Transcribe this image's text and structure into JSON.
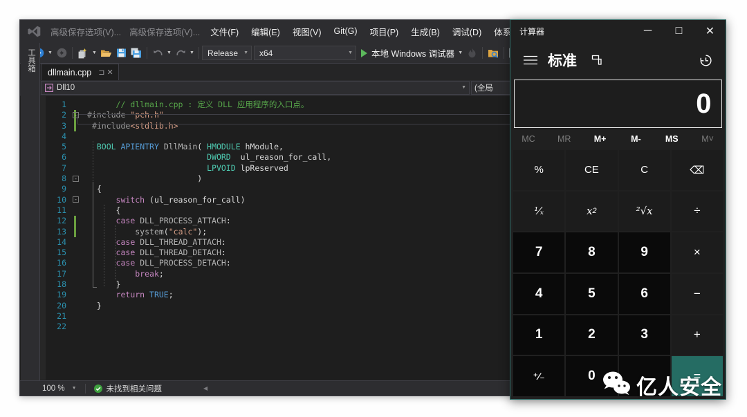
{
  "vs": {
    "logo_name": "visual-studio-logo",
    "menu": {
      "recent_1": "高级保存选项(V)...",
      "recent_2": "高级保存选项(V)...",
      "items": [
        "文件(F)",
        "编辑(E)",
        "视图(V)",
        "Git(G)",
        "项目(P)",
        "生成(B)",
        "调试(D)",
        "体系结构(C)"
      ]
    },
    "toolbar": {
      "config": "Release",
      "platform": "x64",
      "run_label": "本地 Windows 调试器"
    },
    "toolbox_label": "工具箱",
    "tab": {
      "filename": "dllmain.cpp",
      "pin_glyph": "⊐",
      "close_glyph": "✕"
    },
    "navbar": {
      "project": "Dll10",
      "scope": "(全局"
    },
    "status": {
      "zoom": "100 %",
      "message": "未找到相关问题"
    },
    "code": [
      {
        "n": "1",
        "changed": false,
        "fold": "",
        "html": "      <span class='c-com'>// dllmain.cpp : 定义 DLL 应用程序的入口点。</span>"
      },
      {
        "n": "2",
        "changed": true,
        "fold": "-",
        "html": "<span class='c-pre'>#include</span> <span class='c-str'>\"pch.h\"</span>"
      },
      {
        "n": "3",
        "changed": true,
        "fold": "",
        "html": " <span class='c-pre'>#include</span><span class='c-str'>&lt;stdlib.h&gt;</span>"
      },
      {
        "n": "4",
        "changed": false,
        "fold": "",
        "html": ""
      },
      {
        "n": "5",
        "changed": false,
        "fold": "",
        "html": "  <span class='c-typ'>BOOL</span> <span class='c-kw'>APIENTRY</span> <span class='c-mac'>DllMain</span>( <span class='c-typ'>HMODULE</span> hModule,"
      },
      {
        "n": "6",
        "changed": false,
        "fold": "",
        "html": "                         <span class='c-typ'>DWORD</span>  ul_reason_for_call,"
      },
      {
        "n": "7",
        "changed": false,
        "fold": "",
        "html": "                         <span class='c-typ'>LPVOID</span> lpReserved"
      },
      {
        "n": "8",
        "changed": false,
        "fold": "-",
        "html": "                       )"
      },
      {
        "n": "9",
        "changed": false,
        "fold": "",
        "html": "  {"
      },
      {
        "n": "10",
        "changed": false,
        "fold": "-",
        "html": "      <span class='c-kw2'>switch</span> (ul_reason_for_call)"
      },
      {
        "n": "11",
        "changed": false,
        "fold": "",
        "html": "      {"
      },
      {
        "n": "12",
        "changed": true,
        "fold": "",
        "html": "      <span class='c-kw2'>case</span> <span class='c-mac'>DLL_PROCESS_ATTACH</span>:"
      },
      {
        "n": "13",
        "changed": true,
        "fold": "",
        "html": "          <span class='c-mac'>system</span>(<span class='c-str'>\"calc\"</span>);"
      },
      {
        "n": "14",
        "changed": false,
        "fold": "",
        "html": "      <span class='c-kw2'>case</span> <span class='c-mac'>DLL_THREAD_ATTACH</span>:"
      },
      {
        "n": "15",
        "changed": false,
        "fold": "",
        "html": "      <span class='c-kw2'>case</span> <span class='c-mac'>DLL_THREAD_DETACH</span>:"
      },
      {
        "n": "16",
        "changed": false,
        "fold": "",
        "html": "      <span class='c-kw2'>case</span> <span class='c-mac'>DLL_PROCESS_DETACH</span>:"
      },
      {
        "n": "17",
        "changed": false,
        "fold": "",
        "html": "          <span class='c-kw2'>break</span>;"
      },
      {
        "n": "18",
        "changed": false,
        "fold": "",
        "html": "      }"
      },
      {
        "n": "19",
        "changed": false,
        "fold": "",
        "html": "      <span class='c-kw2'>return</span> <span class='c-kw'>TRUE</span>;"
      },
      {
        "n": "20",
        "changed": false,
        "fold": "",
        "html": "  }"
      },
      {
        "n": "21",
        "changed": false,
        "fold": "",
        "html": ""
      },
      {
        "n": "22",
        "changed": false,
        "fold": "",
        "html": ""
      }
    ]
  },
  "calc": {
    "window_title": "计算器",
    "minimize_glyph": "─",
    "maximize_glyph": "□",
    "close_glyph": "✕",
    "mode": "标准",
    "display_value": "0",
    "memory": [
      {
        "label": "MC",
        "enabled": false
      },
      {
        "label": "MR",
        "enabled": false
      },
      {
        "label": "M+",
        "enabled": true
      },
      {
        "label": "M-",
        "enabled": true
      },
      {
        "label": "MS",
        "enabled": true
      },
      {
        "label": "M˅",
        "enabled": false
      }
    ],
    "keys": [
      {
        "label": "%",
        "kind": "fn",
        "name": "percent"
      },
      {
        "label": "CE",
        "kind": "fn",
        "name": "clear-entry"
      },
      {
        "label": "C",
        "kind": "fn",
        "name": "clear"
      },
      {
        "label": "⌫",
        "kind": "fn",
        "name": "backspace"
      },
      {
        "label": "1/x",
        "kind": "fn",
        "name": "reciprocal"
      },
      {
        "label": "x2",
        "kind": "fn",
        "name": "square"
      },
      {
        "label": "²√x",
        "kind": "fn",
        "name": "square-root"
      },
      {
        "label": "÷",
        "kind": "op",
        "name": "divide"
      },
      {
        "label": "7",
        "kind": "num",
        "name": "seven"
      },
      {
        "label": "8",
        "kind": "num",
        "name": "eight"
      },
      {
        "label": "9",
        "kind": "num",
        "name": "nine"
      },
      {
        "label": "×",
        "kind": "op",
        "name": "multiply"
      },
      {
        "label": "4",
        "kind": "num",
        "name": "four"
      },
      {
        "label": "5",
        "kind": "num",
        "name": "five"
      },
      {
        "label": "6",
        "kind": "num",
        "name": "six"
      },
      {
        "label": "−",
        "kind": "op",
        "name": "subtract"
      },
      {
        "label": "1",
        "kind": "num",
        "name": "one"
      },
      {
        "label": "2",
        "kind": "num",
        "name": "two"
      },
      {
        "label": "3",
        "kind": "num",
        "name": "three"
      },
      {
        "label": "+",
        "kind": "op",
        "name": "add"
      },
      {
        "label": "+/-",
        "kind": "num",
        "name": "negate"
      },
      {
        "label": "0",
        "kind": "num",
        "name": "zero"
      },
      {
        "label": ".",
        "kind": "num",
        "name": "decimal"
      },
      {
        "label": "=",
        "kind": "eq",
        "name": "equals"
      }
    ]
  },
  "watermark": {
    "text": "亿人安全",
    "icon": "wechat-icon"
  },
  "colors": {
    "vs_chrome": "#2d2d30",
    "vs_editor_bg": "#1e1e1e",
    "calc_bg": "#202020",
    "calc_accent": "#256c63",
    "calc_border": "#2f6f6a",
    "status_ok": "#3fa13f",
    "run_green": "#5cb85c"
  }
}
